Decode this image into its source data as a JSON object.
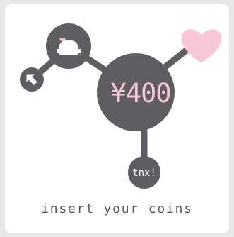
{
  "widget": {
    "amount": "¥400",
    "thanks_label": "tnx!",
    "caption": "insert your coins"
  },
  "icons": {
    "purse": "coin-purse-icon",
    "arrow": "arrow-up-left-icon",
    "heart": "heart-icon"
  },
  "colors": {
    "background": "#e9e8e9",
    "card": "#ffffff",
    "node": "#5f5d62",
    "accent_pink": "#f9c8d8",
    "caption_text": "#58565a"
  }
}
